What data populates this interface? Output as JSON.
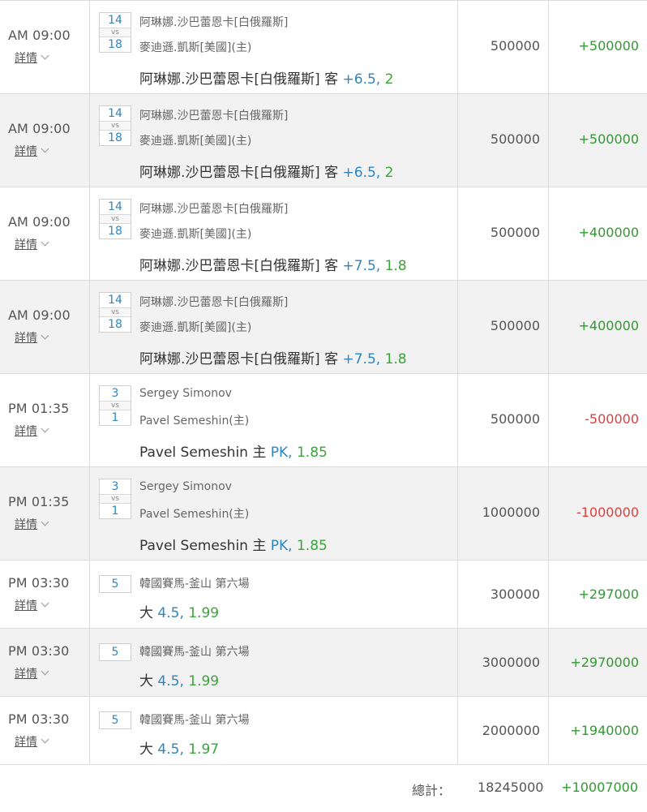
{
  "detail_label": "詳情",
  "vs_label": "vs",
  "rows": [
    {
      "time": "AM 09:00",
      "score_top": "14",
      "score_bottom": "18",
      "team1": "阿琳娜.沙巴蕾恩卡[白俄羅斯]",
      "team2": "麥迪遜.凱斯[美國](主)",
      "pick": "阿琳娜.沙巴蕾恩卡[白俄羅斯] 客",
      "line": "+6.5,",
      "odds": "2",
      "stake": "500000",
      "win": "+500000"
    },
    {
      "time": "AM 09:00",
      "score_top": "14",
      "score_bottom": "18",
      "team1": "阿琳娜.沙巴蕾恩卡[白俄羅斯]",
      "team2": "麥迪遜.凱斯[美國](主)",
      "pick": "阿琳娜.沙巴蕾恩卡[白俄羅斯] 客",
      "line": "+6.5,",
      "odds": "2",
      "stake": "500000",
      "win": "+500000"
    },
    {
      "time": "AM 09:00",
      "score_top": "14",
      "score_bottom": "18",
      "team1": "阿琳娜.沙巴蕾恩卡[白俄羅斯]",
      "team2": "麥迪遜.凱斯[美國](主)",
      "pick": "阿琳娜.沙巴蕾恩卡[白俄羅斯] 客",
      "line": "+7.5,",
      "odds": "1.8",
      "stake": "500000",
      "win": "+400000"
    },
    {
      "time": "AM 09:00",
      "score_top": "14",
      "score_bottom": "18",
      "team1": "阿琳娜.沙巴蕾恩卡[白俄羅斯]",
      "team2": "麥迪遜.凱斯[美國](主)",
      "pick": "阿琳娜.沙巴蕾恩卡[白俄羅斯] 客",
      "line": "+7.5,",
      "odds": "1.8",
      "stake": "500000",
      "win": "+400000"
    },
    {
      "time": "PM 01:35",
      "score_top": "3",
      "score_bottom": "1",
      "team1": "Sergey Simonov",
      "team2": "Pavel Semeshin(主)",
      "pick": "Pavel Semeshin 主",
      "line": "PK,",
      "odds": "1.85",
      "stake": "500000",
      "win": "-500000"
    },
    {
      "time": "PM 01:35",
      "score_top": "3",
      "score_bottom": "1",
      "team1": "Sergey Simonov",
      "team2": "Pavel Semeshin(主)",
      "pick": "Pavel Semeshin 主",
      "line": "PK,",
      "odds": "1.85",
      "stake": "1000000",
      "win": "-1000000"
    },
    {
      "time": "PM 03:30",
      "score": "5",
      "event": "韓國賽馬-釜山 第六場",
      "pick": "大",
      "line": "4.5,",
      "odds": "1.99",
      "stake": "300000",
      "win": "+297000"
    },
    {
      "time": "PM 03:30",
      "score": "5",
      "event": "韓國賽馬-釜山 第六場",
      "pick": "大",
      "line": "4.5,",
      "odds": "1.99",
      "stake": "3000000",
      "win": "+2970000"
    },
    {
      "time": "PM 03:30",
      "score": "5",
      "event": "韓國賽馬-釜山 第六場",
      "pick": "大",
      "line": "4.5,",
      "odds": "1.97",
      "stake": "2000000",
      "win": "+1940000"
    }
  ],
  "totals": {
    "label": "總計：",
    "stake": "18245000",
    "win": "+10007000"
  },
  "colors": {
    "positive": "#2f9a2f",
    "negative": "#e23c3c",
    "link_blue": "#2e86c1",
    "row_alt_bg": "#f2f2f2"
  }
}
